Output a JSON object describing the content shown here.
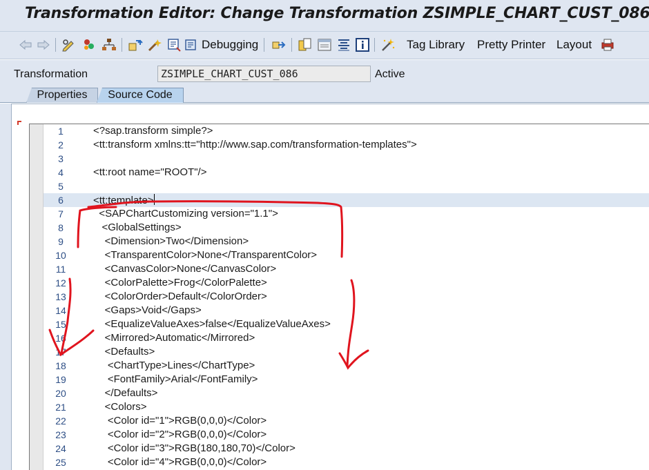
{
  "window": {
    "title": "Transformation Editor: Change Transformation ZSIMPLE_CHART_CUST_086"
  },
  "toolbar": {
    "icons": [
      "back-icon",
      "forward-icon",
      "display-change-icon",
      "activate-icon",
      "object-list-icon",
      "where-used-icon",
      "check-icon",
      "test-icon",
      "debugging-icon",
      "navigate-icon",
      "copy-icon",
      "pattern-icon",
      "align-icon",
      "info-icon",
      "wizard-icon",
      "print-icon"
    ],
    "debugging_label": "Debugging",
    "tag_library_label": "Tag Library",
    "pretty_printer_label": "Pretty Printer",
    "layout_label": "Layout"
  },
  "attributes": {
    "label": "Transformation",
    "value": "ZSIMPLE_CHART_CUST_086",
    "status": "Active"
  },
  "tabs": [
    {
      "label": "Properties"
    },
    {
      "label": "Source Code"
    }
  ],
  "editor": {
    "lines": [
      {
        "n": "1",
        "code": "<?sap.transform simple?>"
      },
      {
        "n": "2",
        "code": "<tt:transform xmlns:tt=\"http://www.sap.com/transformation-templates\">"
      },
      {
        "n": "3",
        "code": ""
      },
      {
        "n": "4",
        "code": "<tt:root name=\"ROOT\"/>"
      },
      {
        "n": "5",
        "code": ""
      },
      {
        "n": "6",
        "code": "<tt:template>"
      },
      {
        "n": "7",
        "code": "  <SAPChartCustomizing version=\"1.1\">"
      },
      {
        "n": "8",
        "code": "   <GlobalSettings>"
      },
      {
        "n": "9",
        "code": "    <Dimension>Two</Dimension>"
      },
      {
        "n": "10",
        "code": "    <TransparentColor>None</TransparentColor>"
      },
      {
        "n": "11",
        "code": "    <CanvasColor>None</CanvasColor>"
      },
      {
        "n": "12",
        "code": "    <ColorPalette>Frog</ColorPalette>"
      },
      {
        "n": "13",
        "code": "    <ColorOrder>Default</ColorOrder>"
      },
      {
        "n": "14",
        "code": "    <Gaps>Void</Gaps>"
      },
      {
        "n": "15",
        "code": "    <EqualizeValueAxes>false</EqualizeValueAxes>"
      },
      {
        "n": "16",
        "code": "    <Mirrored>Automatic</Mirrored>"
      },
      {
        "n": "17",
        "code": "    <Defaults>"
      },
      {
        "n": "18",
        "code": "     <ChartType>Lines</ChartType>"
      },
      {
        "n": "19",
        "code": "     <FontFamily>Arial</FontFamily>"
      },
      {
        "n": "20",
        "code": "    </Defaults>"
      },
      {
        "n": "21",
        "code": "    <Colors>"
      },
      {
        "n": "22",
        "code": "     <Color id=\"1\">RGB(0,0,0)</Color>"
      },
      {
        "n": "23",
        "code": "     <Color id=\"2\">RGB(0,0,0)</Color>"
      },
      {
        "n": "24",
        "code": "     <Color id=\"3\">RGB(180,180,70)</Color>"
      },
      {
        "n": "25",
        "code": "     <Color id=\"4\">RGB(0,0,0)</Color>"
      }
    ],
    "current_line": "6"
  },
  "colors": {
    "chrome": "#dfe6f1",
    "line_number": "#2d4e85",
    "current_line_bg": "#dce6f2",
    "annotation_red": "#e0141e"
  }
}
